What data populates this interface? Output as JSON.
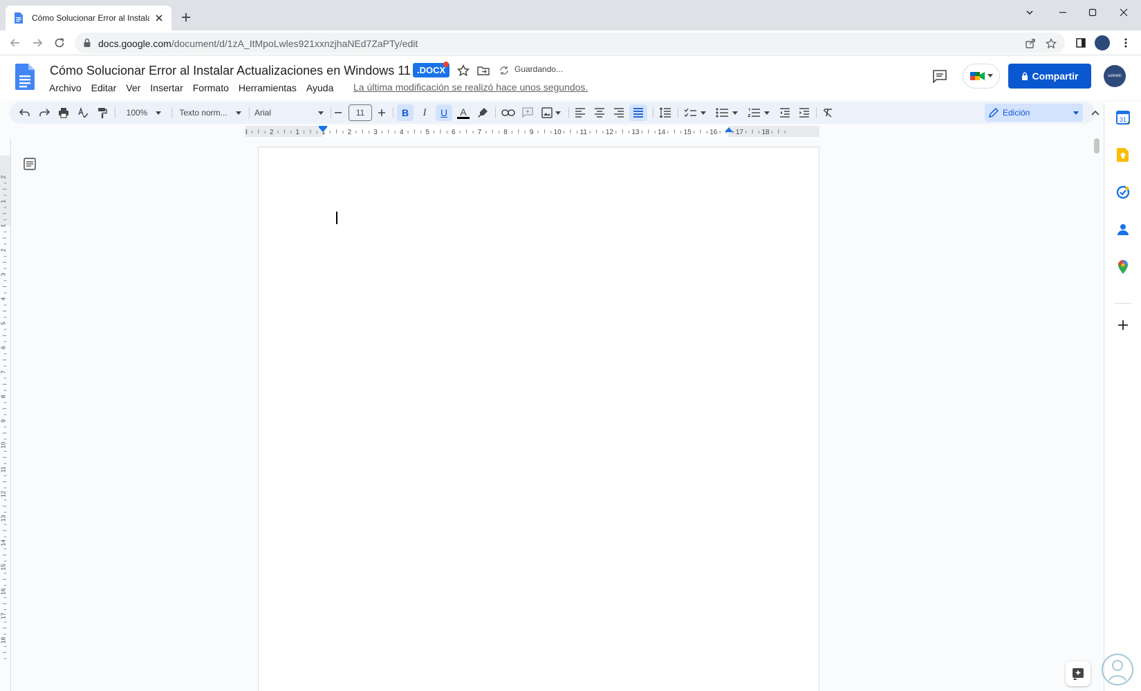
{
  "browser": {
    "tab_title": "Cómo Solucionar Error al Instalar",
    "url_host": "docs.google.com",
    "url_path": "/document/d/1zA_ItMpoLwles921xxnzjhaNEd7ZaPTy/edit"
  },
  "doc": {
    "title": "Cómo Solucionar Error al Instalar Actualizaciones en Windows 11",
    "badge": ".DOCX",
    "save_status": "Guardando...",
    "last_edit": "La última modificación se realizó hace unos segundos.",
    "share_label": "Compartir",
    "avatar_text": "solvetic"
  },
  "menu": [
    "Archivo",
    "Editar",
    "Ver",
    "Insertar",
    "Formato",
    "Herramientas",
    "Ayuda"
  ],
  "toolbar": {
    "zoom": "100%",
    "style": "Texto norm...",
    "font": "Arial",
    "font_size": "11",
    "bold": "B",
    "italic": "I",
    "underline": "U",
    "text_color_glyph": "A",
    "mode": "Edición"
  },
  "ruler": {
    "top_labels": [
      "3",
      "2",
      "1",
      "1",
      "2",
      "3",
      "4",
      "5",
      "6",
      "7",
      "8",
      "9",
      "10",
      "11",
      "12",
      "13",
      "14",
      "15",
      "16",
      "17",
      "18"
    ],
    "left_labels": [
      "2",
      "1",
      "1",
      "2",
      "3",
      "4",
      "5",
      "6",
      "7",
      "8",
      "9",
      "10",
      "11",
      "12",
      "13",
      "14",
      "15",
      "16",
      "17",
      "18"
    ]
  },
  "side_panel": {
    "calendar_day": "31",
    "icons": [
      "calendar-icon",
      "keep-icon",
      "tasks-icon",
      "contacts-icon",
      "maps-icon",
      "add-icon"
    ]
  },
  "colors": {
    "accent": "#1a73e8",
    "share": "#0b57d0",
    "toolbar_bg": "#edf2fa",
    "tab_strip": "#dee1e6"
  }
}
